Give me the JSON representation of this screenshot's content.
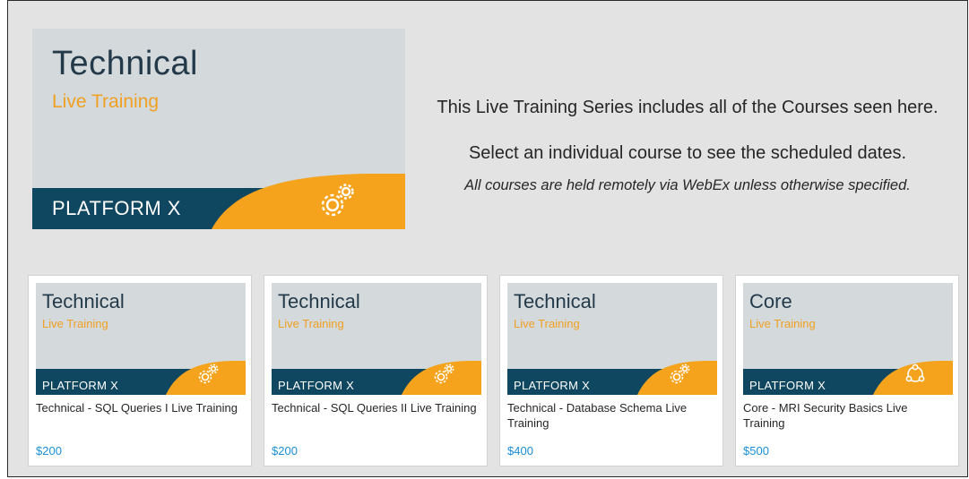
{
  "hero": {
    "title": "Technical",
    "subtitle": "Live Training",
    "brand": "PLATFORM X",
    "icon": "gears-icon"
  },
  "intro": {
    "line1": "This Live Training Series includes all of the Courses seen here.",
    "line2": "Select an individual course to see the scheduled dates.",
    "note": "All courses are held remotely via WebEx unless otherwise specified."
  },
  "colors": {
    "navy": "#0f4660",
    "orange": "#f5a31c",
    "price_blue": "#1a8fd6",
    "title_dark": "#233a4a"
  },
  "courses": [
    {
      "thumb_title": "Technical",
      "thumb_subtitle": "Live Training",
      "brand": "PLATFORM X",
      "icon": "gears-icon",
      "name": "Technical - SQL Queries I Live Training",
      "price": "$200"
    },
    {
      "thumb_title": "Technical",
      "thumb_subtitle": "Live Training",
      "brand": "PLATFORM X",
      "icon": "gears-icon",
      "name": "Technical - SQL Queries II Live Training",
      "price": "$200"
    },
    {
      "thumb_title": "Technical",
      "thumb_subtitle": "Live Training",
      "brand": "PLATFORM X",
      "icon": "gears-icon",
      "name": "Technical - Database Schema Live Training",
      "price": "$400"
    },
    {
      "thumb_title": "Core",
      "thumb_subtitle": "Live Training",
      "brand": "PLATFORM X",
      "icon": "network-icon",
      "name": "Core - MRI Security Basics Live Training",
      "price": "$500"
    }
  ]
}
